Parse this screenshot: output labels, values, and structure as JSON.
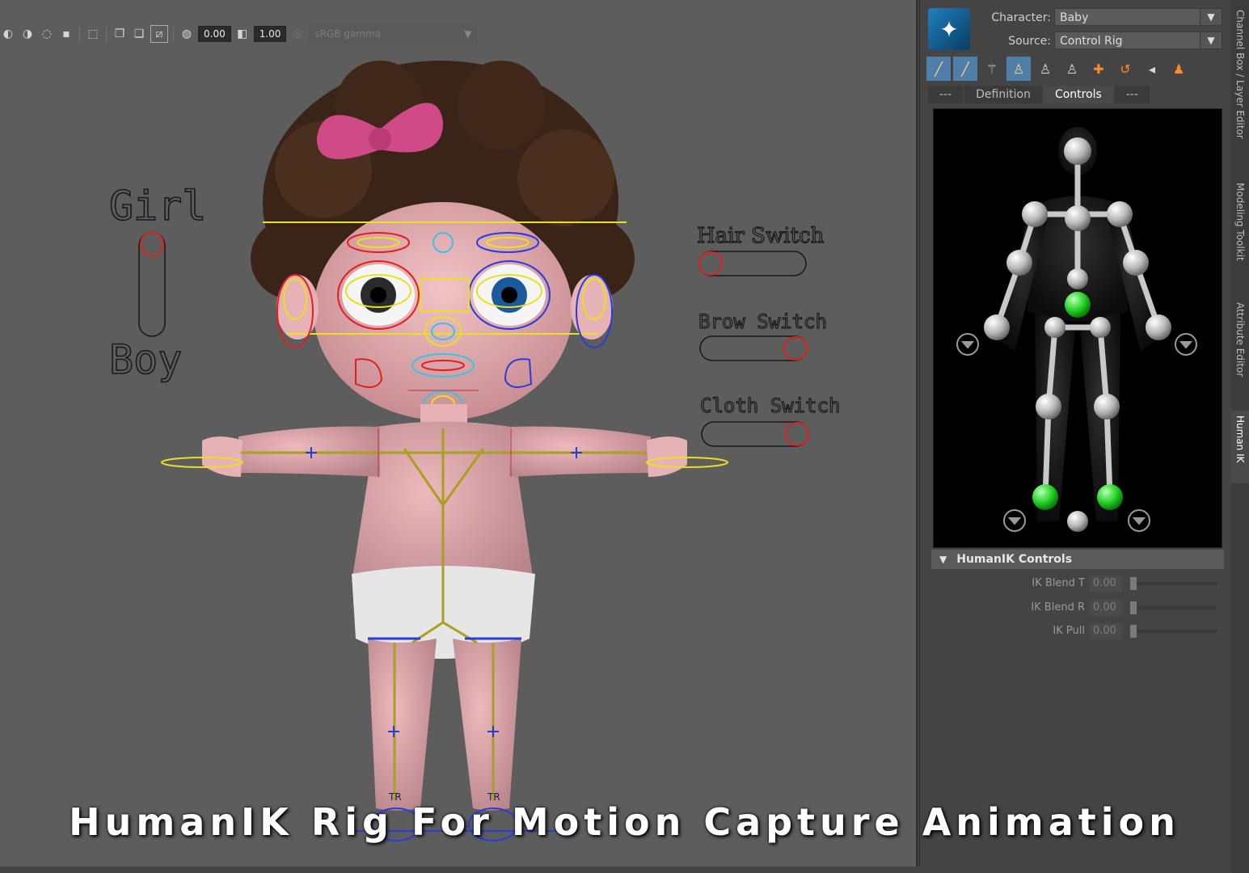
{
  "viewport": {
    "toolbar": {
      "exposure": "0.00",
      "gamma": "1.00",
      "color_space": "sRGB gamma"
    },
    "scene": {
      "gender_switch": {
        "top_label": "Girl",
        "bottom_label": "Boy"
      },
      "switches": [
        {
          "label": "Hair Switch"
        },
        {
          "label": "Brow Switch"
        },
        {
          "label": "Cloth Switch"
        }
      ],
      "joint_labels": [
        "TR",
        "TR"
      ]
    }
  },
  "caption": "HumanIK Rig For Motion Capture Animation",
  "panel": {
    "character_label": "Character:",
    "character_value": "Baby",
    "source_label": "Source:",
    "source_value": "Control Rig",
    "tabs": [
      "---",
      "Definition",
      "Controls",
      "---"
    ],
    "active_tab": "Controls",
    "section": "HumanIK Controls",
    "sliders": [
      {
        "label": "IK Blend T",
        "value": "0.00"
      },
      {
        "label": "IK Blend R",
        "value": "0.00"
      },
      {
        "label": "IK Pull",
        "value": "0.00"
      }
    ]
  },
  "side_tabs": [
    "Channel Box / Layer Editor",
    "Modeling Toolkit",
    "Attribute Editor",
    "Human IK"
  ]
}
